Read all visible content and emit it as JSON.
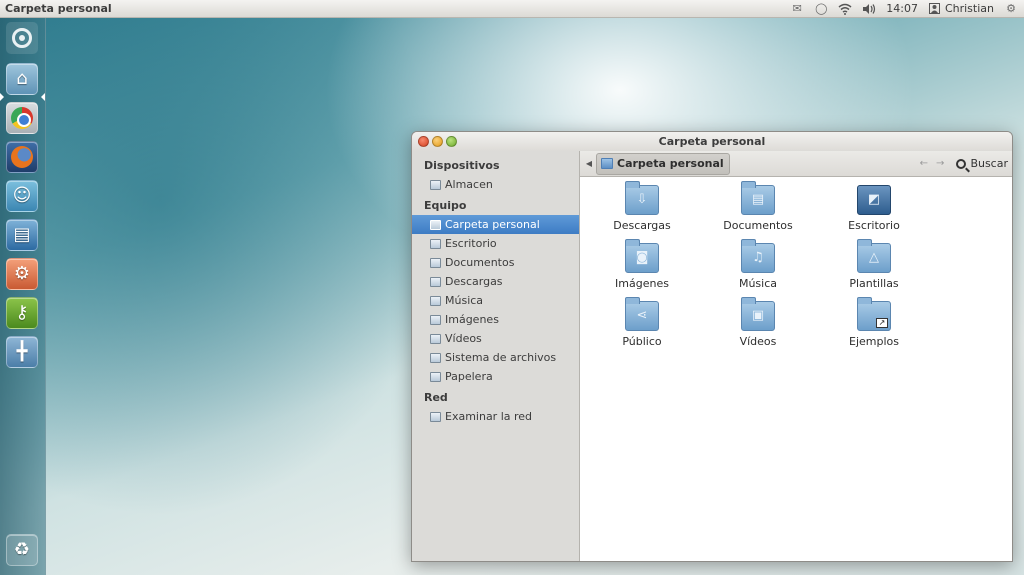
{
  "top_panel": {
    "app_title": "Carpeta personal",
    "clock": "14:07",
    "user": "Christian",
    "icons": [
      "mail-icon",
      "messaging-icon",
      "wifi-icon",
      "volume-icon",
      "user-icon",
      "gear-icon"
    ]
  },
  "launcher": {
    "items": [
      {
        "name": "dash-home-button",
        "icon": "ubuntu-logo-icon"
      },
      {
        "name": "home-folder-launcher",
        "icon": "home-folder-icon"
      },
      {
        "name": "chrome-launcher",
        "icon": "chrome-icon"
      },
      {
        "name": "firefox-launcher",
        "icon": "firefox-icon"
      },
      {
        "name": "empathy-launcher",
        "icon": "chat-icon"
      },
      {
        "name": "writer-launcher",
        "icon": "document-icon"
      },
      {
        "name": "office-launcher",
        "icon": "presentation-icon"
      },
      {
        "name": "keys-launcher",
        "icon": "key-icon"
      },
      {
        "name": "workspace-launcher",
        "icon": "workspace-switcher-icon"
      },
      {
        "name": "trash-launcher",
        "icon": "trash-icon"
      }
    ]
  },
  "window": {
    "title": "Carpeta personal",
    "sidebar": {
      "sections": [
        {
          "heading": "Dispositivos",
          "items": [
            {
              "label": "Almacen"
            }
          ]
        },
        {
          "heading": "Equipo",
          "items": [
            {
              "label": "Carpeta personal",
              "selected": true
            },
            {
              "label": "Escritorio"
            },
            {
              "label": "Documentos"
            },
            {
              "label": "Descargas"
            },
            {
              "label": "Música"
            },
            {
              "label": "Imágenes"
            },
            {
              "label": "Vídeos"
            },
            {
              "label": "Sistema de archivos"
            },
            {
              "label": "Papelera"
            }
          ]
        },
        {
          "heading": "Red",
          "items": [
            {
              "label": "Examinar la red"
            }
          ]
        }
      ]
    },
    "toolbar": {
      "breadcrumb": "Carpeta personal",
      "search_label": "Buscar"
    },
    "files": [
      {
        "label": "Descargas",
        "icon": "download-folder-icon",
        "glyph": "⇩"
      },
      {
        "label": "Documentos",
        "icon": "documents-folder-icon",
        "glyph": "▤"
      },
      {
        "label": "Escritorio",
        "icon": "desktop-folder-icon",
        "glyph": "◩"
      },
      {
        "label": "Imágenes",
        "icon": "pictures-folder-icon",
        "glyph": "◙"
      },
      {
        "label": "Música",
        "icon": "music-folder-icon",
        "glyph": "♫"
      },
      {
        "label": "Plantillas",
        "icon": "templates-folder-icon",
        "glyph": "△"
      },
      {
        "label": "Público",
        "icon": "public-folder-icon",
        "glyph": "⋖"
      },
      {
        "label": "Vídeos",
        "icon": "videos-folder-icon",
        "glyph": "▣"
      },
      {
        "label": "Ejemplos",
        "icon": "examples-folder-icon",
        "glyph": ""
      }
    ]
  }
}
